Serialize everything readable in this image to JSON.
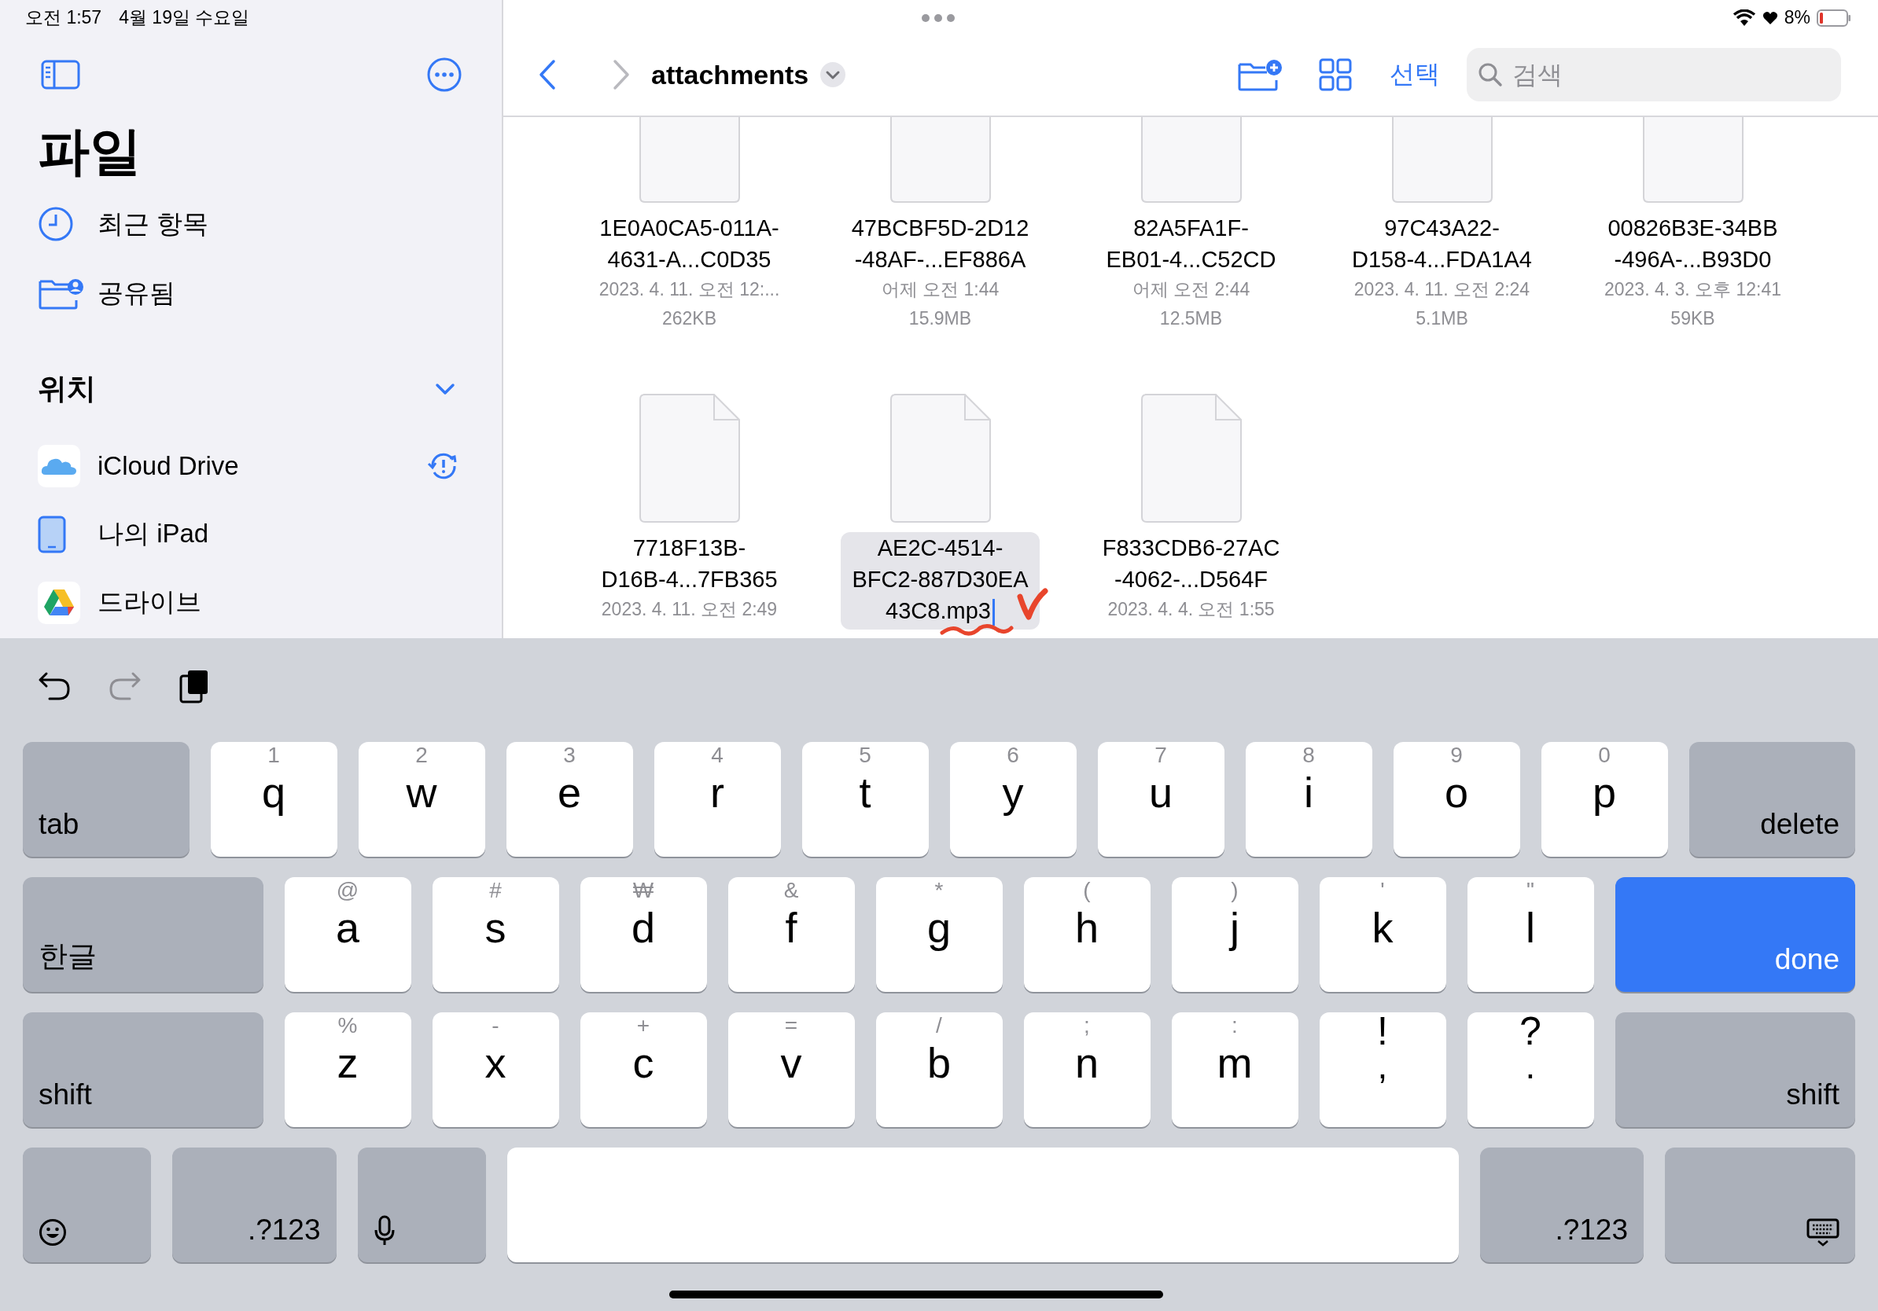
{
  "status_bar": {
    "time": "오전 1:57",
    "date": "4월 19일 수요일",
    "battery": "8%"
  },
  "sidebar": {
    "title": "파일",
    "items": [
      {
        "label": "최근 항목",
        "kind": "recents"
      },
      {
        "label": "공유됨",
        "kind": "shared"
      }
    ],
    "section": {
      "title": "위치",
      "expanded": true,
      "items": [
        {
          "label": "iCloud Drive",
          "kind": "icloud",
          "alert": true
        },
        {
          "label": "나의 iPad",
          "kind": "ipad",
          "alert": false
        },
        {
          "label": "드라이브",
          "kind": "gdrive",
          "alert": false
        }
      ]
    }
  },
  "toolbar": {
    "title": "attachments",
    "select": "선택",
    "search": {
      "placeholder": "검색"
    }
  },
  "files": [
    {
      "name": "1E0A0CA5-011A-\n4631-A...C0D35",
      "date": "2023. 4. 11. 오전 12:...",
      "size": "262KB",
      "selected": false
    },
    {
      "name": "47BCBF5D-2D12\n-48AF-...EF886A",
      "date": "어제 오전 1:44",
      "size": "15.9MB",
      "selected": false
    },
    {
      "name": "82A5FA1F-\nEB01-4...C52CD",
      "date": "어제 오전 2:44",
      "size": "12.5MB",
      "selected": false
    },
    {
      "name": "97C43A22-\nD158-4...FDA1A4",
      "date": "2023. 4. 11. 오전 2:24",
      "size": "5.1MB",
      "selected": false
    },
    {
      "name": "00826B3E-34BB\n-496A-...B93D0",
      "date": "2023. 4. 3. 오후 12:41",
      "size": "59KB",
      "selected": false
    },
    {
      "name": "7718F13B-\nD16B-4...7FB365",
      "date": "2023. 4. 11. 오전 2:49",
      "selected": false
    },
    {
      "name": "AE2C-4514-\nBFC2-887D30EA\n43C8.mp3",
      "selected": true
    },
    {
      "name": "F833CDB6-27AC\n-4062-...D564F",
      "date": "2023. 4. 4. 오전 1:55",
      "selected": false
    }
  ],
  "keyboard": {
    "rows": [
      [
        {
          "kind": "function",
          "label": "tab"
        },
        {
          "kind": "letter",
          "label": "q",
          "hint": "1"
        },
        {
          "kind": "letter",
          "label": "w",
          "hint": "2"
        },
        {
          "kind": "letter",
          "label": "e",
          "hint": "3"
        },
        {
          "kind": "letter",
          "label": "r",
          "hint": "4"
        },
        {
          "kind": "letter",
          "label": "t",
          "hint": "5"
        },
        {
          "kind": "letter",
          "label": "y",
          "hint": "6"
        },
        {
          "kind": "letter",
          "label": "u",
          "hint": "7"
        },
        {
          "kind": "letter",
          "label": "i",
          "hint": "8"
        },
        {
          "kind": "letter",
          "label": "o",
          "hint": "9"
        },
        {
          "kind": "letter",
          "label": "p",
          "hint": "0"
        },
        {
          "kind": "function",
          "label": "delete"
        }
      ],
      [
        {
          "kind": "function",
          "label": "한글"
        },
        {
          "kind": "letter",
          "label": "a",
          "hint": "@"
        },
        {
          "kind": "letter",
          "label": "s",
          "hint": "#"
        },
        {
          "kind": "letter",
          "label": "d",
          "hint": "₩"
        },
        {
          "kind": "letter",
          "label": "f",
          "hint": "&"
        },
        {
          "kind": "letter",
          "label": "g",
          "hint": "*"
        },
        {
          "kind": "letter",
          "label": "h",
          "hint": "("
        },
        {
          "kind": "letter",
          "label": "j",
          "hint": ")"
        },
        {
          "kind": "letter",
          "label": "k",
          "hint": "'"
        },
        {
          "kind": "letter",
          "label": "l",
          "hint": "\""
        },
        {
          "kind": "action",
          "label": "done"
        }
      ],
      [
        {
          "kind": "function",
          "label": "shift"
        },
        {
          "kind": "letter",
          "label": "z",
          "hint": "%"
        },
        {
          "kind": "letter",
          "label": "x",
          "hint": "-"
        },
        {
          "kind": "letter",
          "label": "c",
          "hint": "+"
        },
        {
          "kind": "letter",
          "label": "v",
          "hint": "="
        },
        {
          "kind": "letter",
          "label": "b",
          "hint": "/"
        },
        {
          "kind": "letter",
          "label": "n",
          "hint": ";"
        },
        {
          "kind": "letter",
          "label": "m",
          "hint": ":"
        },
        {
          "kind": "dual",
          "label": ",",
          "hint": "!"
        },
        {
          "kind": "dual",
          "label": ".",
          "hint": "?"
        },
        {
          "kind": "function",
          "label": "shift"
        }
      ],
      [
        {
          "kind": "emoji"
        },
        {
          "kind": "function",
          "label": ".?123"
        },
        {
          "kind": "mic"
        },
        {
          "kind": "space"
        },
        {
          "kind": "function",
          "label": ".?123"
        },
        {
          "kind": "dismiss"
        }
      ]
    ]
  }
}
